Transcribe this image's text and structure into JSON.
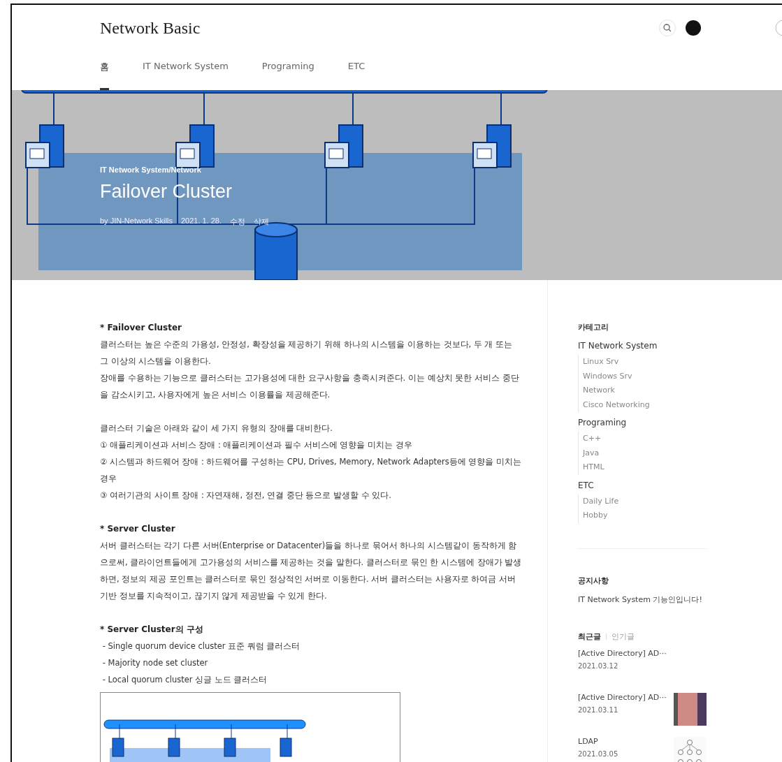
{
  "blog_title": "Network Basic",
  "nav": [
    {
      "label": "홈",
      "selected": true
    },
    {
      "label": "IT Network System",
      "selected": false
    },
    {
      "label": "Programing",
      "selected": false
    },
    {
      "label": "ETC",
      "selected": false
    }
  ],
  "post": {
    "category": "IT Network System/Network",
    "title": "Failover Cluster",
    "author": "by JIN-Network Skills",
    "date": "2021. 1. 28.",
    "actions": [
      "수정",
      "삭제"
    ]
  },
  "article": [
    {
      "kind": "heading",
      "text": "* Failover Cluster"
    },
    {
      "kind": "paragraph",
      "text": "클러스터는 높은 수준의 가용성, 안정성, 확장성을 제공하기 위해 하나의 시스템을 이용하는 것보다, 두 개 또는 그 이상의 시스템을 이용한다."
    },
    {
      "kind": "paragraph",
      "text": "장애를 수용하는 기능으로 클러스터는 고가용성에 대한 요구사항을 충족시켜준다. 이는 예상치 못한 서비스 중단을 감소시키고, 사용자에게 높은 서비스 이용률을 제공해준다."
    },
    {
      "kind": "spacer"
    },
    {
      "kind": "paragraph",
      "text": "클러스터 기술은 아래와 같이 세 가지 유형의 장애를 대비한다."
    },
    {
      "kind": "paragraph",
      "text": "① 애플리케이션과 서비스 장애 : 애플리케이션과 필수 서비스에 영향을 미치는 경우"
    },
    {
      "kind": "paragraph",
      "text": "② 시스템과 하드웨어 장애 : 하드웨어를 구성하는 CPU, Drives, Memory, Network Adapters등에 영향을 미치는 경우"
    },
    {
      "kind": "paragraph",
      "text": "③ 여러기관의 사이트 장애 : 자연재해, 정전, 연결 중단 등으로 발생할 수 있다."
    },
    {
      "kind": "spacer"
    },
    {
      "kind": "heading",
      "text": "* Server Cluster"
    },
    {
      "kind": "paragraph",
      "text": "서버 클러스터는 각기 다른 서버(Enterprise or Datacenter)들을 하나로 묶어서 하나의 시스템같이 동작하게 함으로써, 클라이언트들에게 고가용성의 서비스를 제공하는 것을 말한다. 클러스터로 묶인 한 시스템에 장애가 발생하면, 정보의 제공 포인트는 클러스터로 묶인 정상적인 서버로 이동한다. 서버 클러스터는 사용자로 하여금 서버 기반 정보를 지속적이고, 끊기지 않게 제공받을 수 있게 한다."
    },
    {
      "kind": "spacer"
    },
    {
      "kind": "heading",
      "text": "* Server Cluster의 구성"
    },
    {
      "kind": "paragraph",
      "text": " - Single quorum device cluster 표준 쿼럼 클러스터"
    },
    {
      "kind": "paragraph",
      "text": " - Majority node set cluster"
    },
    {
      "kind": "paragraph",
      "text": " - Local quorum cluster 싱글 노드 클러스터"
    },
    {
      "kind": "figure"
    }
  ],
  "sidebar": {
    "categories_title": "카테고리",
    "categories": [
      {
        "label": "IT Network System",
        "children": [
          {
            "label": "Linux Srv"
          },
          {
            "label": "Windows Srv"
          },
          {
            "label": "Network"
          },
          {
            "label": "Cisco Networking"
          }
        ]
      },
      {
        "label": "Programing",
        "children": [
          {
            "label": "C++"
          },
          {
            "label": "Java"
          },
          {
            "label": "HTML"
          }
        ]
      },
      {
        "label": "ETC",
        "children": [
          {
            "label": "Daily Life"
          },
          {
            "label": "Hobby"
          }
        ]
      }
    ],
    "notice_title": "공지사항",
    "notice": "IT Network System 기능인입니다!",
    "post_tabs": [
      {
        "label": "최근글",
        "selected": true
      },
      {
        "label": "인기글",
        "selected": false
      }
    ],
    "posts": [
      {
        "title": "[Active Directory] AD···",
        "date": "2021.03.12",
        "kind": "plain"
      },
      {
        "title": "[Active Directory] AD···",
        "date": "2021.03.11",
        "kind": "photo"
      },
      {
        "title": "LDAP",
        "date": "2021.03.05",
        "kind": "diagram"
      }
    ]
  }
}
